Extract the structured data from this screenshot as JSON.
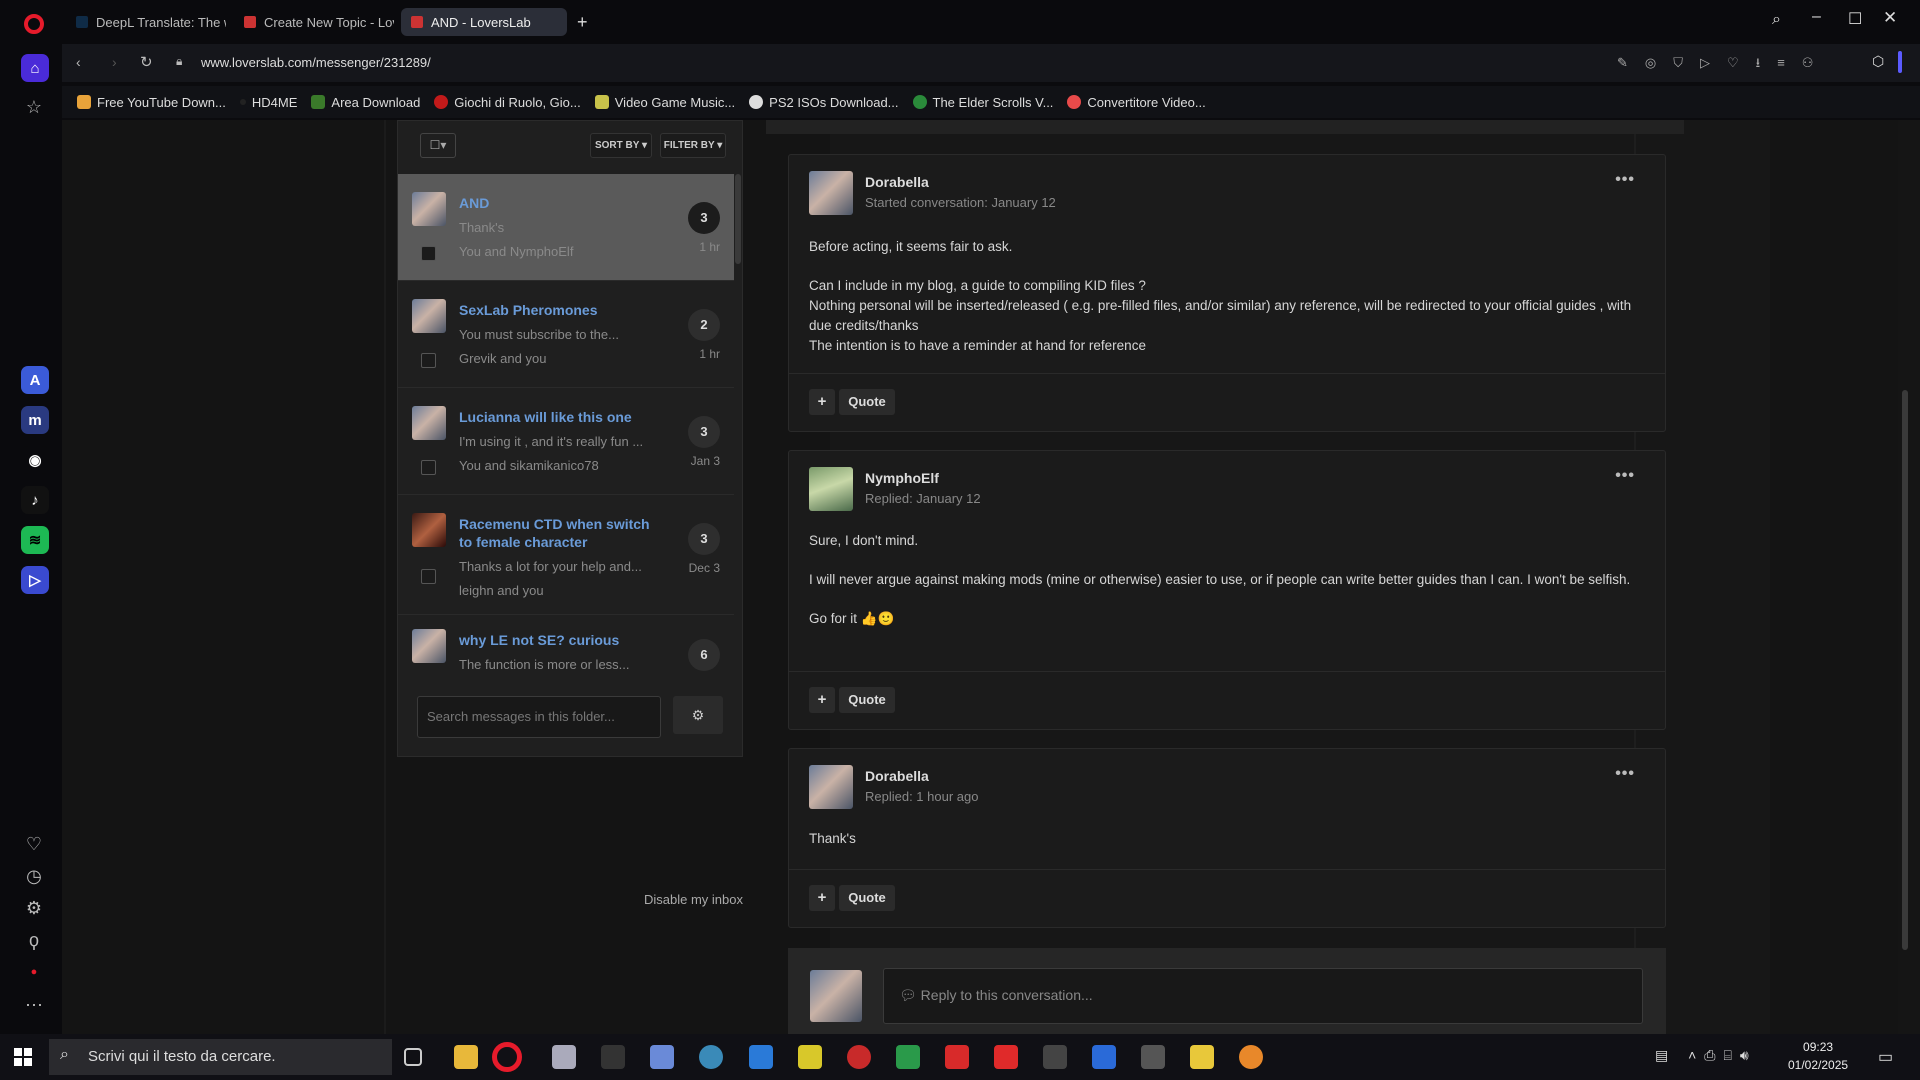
{
  "browser": {
    "tabs": [
      {
        "label": "DeepL Translate: The worl",
        "active": false
      },
      {
        "label": "Create New Topic - Lovers",
        "active": false
      },
      {
        "label": "AND - LoversLab",
        "active": true
      }
    ],
    "new_tab_icon": "plus-icon",
    "url": "www.loverslab.com/messenger/231289/",
    "bookmarks": [
      "Free YouTube Down...",
      "HD4ME",
      "Area Download",
      "Giochi di Ruolo, Gio...",
      "Video Game Music...",
      "PS2 ISOs Download...",
      "The Elder Scrolls V...",
      "Convertitore Video..."
    ]
  },
  "inbox": {
    "sort_label": "SORT BY",
    "filter_label": "FILTER BY",
    "conversations": [
      {
        "title": "AND",
        "snippet": "Thank's",
        "participants": "You and NymphoElf",
        "count": "3",
        "time": "1 hr",
        "selected": true
      },
      {
        "title": "SexLab Pheromones",
        "snippet": "You must subscribe to the...",
        "participants": "Grevik and you",
        "count": "2",
        "time": "1 hr",
        "selected": false
      },
      {
        "title": "Lucianna will like this one",
        "snippet": "I'm using it , and it's really fun ...",
        "participants": "You and sikamikanico78",
        "count": "3",
        "time": "Jan 3",
        "selected": false
      },
      {
        "title": "Racemenu CTD when switch to female character",
        "snippet": "Thanks a lot for your help and...",
        "participants": "leighn and you",
        "count": "3",
        "time": "Dec 3",
        "selected": false
      },
      {
        "title": "why LE not SE? curious",
        "snippet": "The function is more or less...",
        "participants": "",
        "count": "6",
        "time": "",
        "selected": false
      }
    ],
    "search_placeholder": "Search messages in this folder...",
    "disable_label": "Disable my inbox"
  },
  "messages": [
    {
      "author": "Dorabella",
      "date": "Started conversation: January 12",
      "body": [
        "Before acting, it seems fair to ask.",
        "",
        "Can I include in my blog, a guide to compiling KID files ?",
        "Nothing personal will be inserted/released ( e.g. pre-filled files, and/or similar) any reference, will be redirected to your official guides , with due credits/thanks",
        "The intention is to have a reminder at hand for reference"
      ]
    },
    {
      "author": "NymphoElf",
      "date": "Replied: January 12",
      "body": [
        "Sure, I don't mind.",
        "",
        "I will never argue against making mods (mine or otherwise) easier to use, or if people can write better guides than I can. I won't be selfish.",
        "",
        "Go for it 👍🙂"
      ]
    },
    {
      "author": "Dorabella",
      "date": "Replied: 1 hour ago",
      "body": [
        "Thank's"
      ]
    }
  ],
  "quote_label": "Quote",
  "reply_placeholder": "Reply to this conversation...",
  "taskbar": {
    "search_placeholder": "Scrivi qui il testo da cercare.",
    "time": "09:23",
    "date": "01/02/2025"
  },
  "colors": {
    "link": "#6a9bd8",
    "accent": "#5b5bff",
    "opera": "#e61b2b"
  }
}
